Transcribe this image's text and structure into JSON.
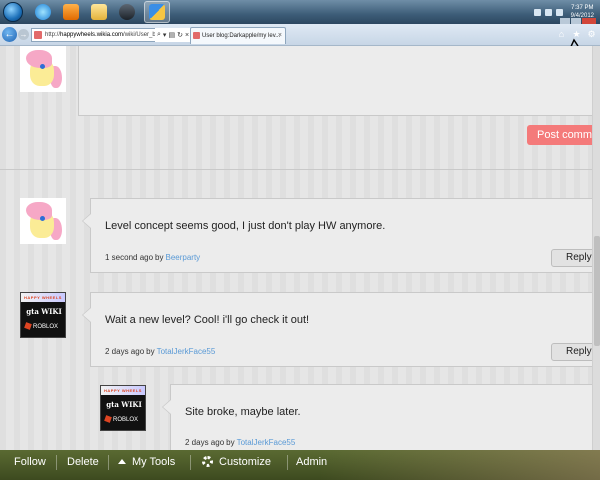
{
  "taskbar": {
    "clock_time": "7:37 PM",
    "clock_date": "9/4/2012"
  },
  "browser": {
    "address_prefix": "http://",
    "address_domain": "happywheels.wikia.com",
    "address_path": "/wiki/User_b",
    "tab_title": "User blog:Darkapple/my lev...",
    "tab_close": "×"
  },
  "page": {
    "post_button": "Post comm",
    "comments": [
      {
        "text": "Level concept seems good, I just don't play HW anymore.",
        "time": "1 second ago",
        "by": "by",
        "user": "Beerparty",
        "reply": "Reply"
      },
      {
        "text": "Wait a new level? Cool! i'll go check it out!",
        "time": "2 days ago",
        "by": "by",
        "user": "TotalJerkFace55",
        "reply": "Reply"
      },
      {
        "text": "Site broke, maybe later.",
        "time": "2 days ago",
        "by": "by",
        "user": "TotalJerkFace55"
      }
    ],
    "avatar_text": {
      "happy_wheels": "HAPPY WHEELS",
      "gta_wiki": "gta WIKI",
      "roblox": "ROBLOX"
    }
  },
  "toolbar": {
    "follow": "Follow",
    "delete": "Delete",
    "my_tools": "My Tools",
    "customize": "Customize",
    "admin": "Admin"
  },
  "colors": {
    "post_button": "#f47a7a",
    "username_link": "#5a9ad6",
    "toolbar": "#4a5a28"
  }
}
